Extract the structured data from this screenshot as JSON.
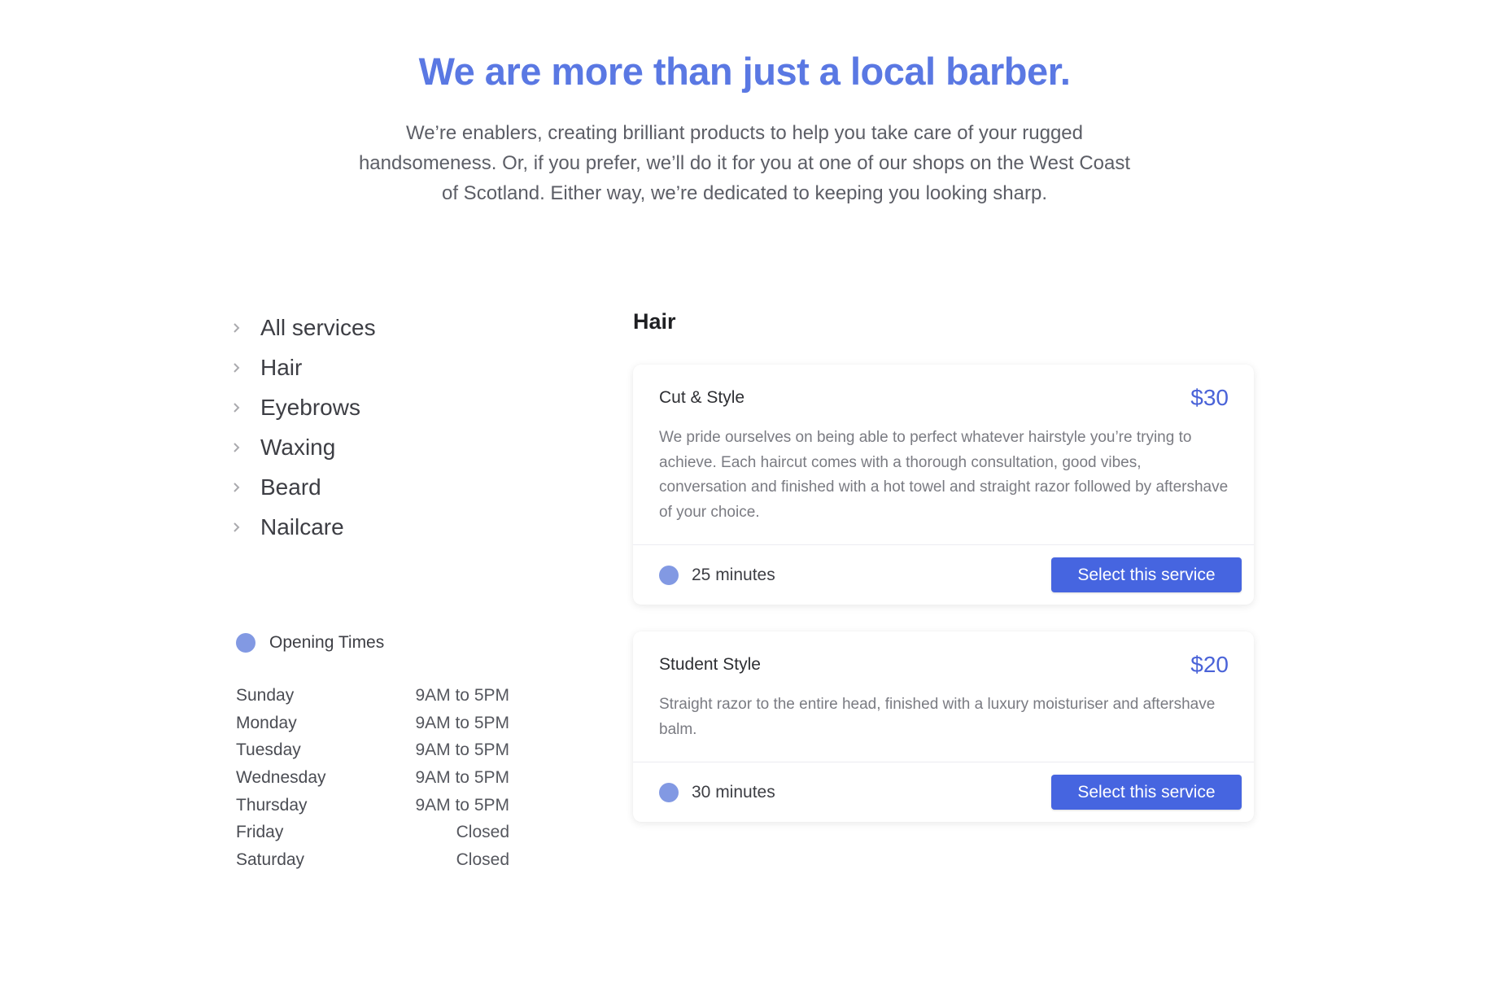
{
  "hero": {
    "title": "We are more than just a local barber.",
    "text": "We’re enablers, creating brilliant products to help you take care of your rugged handsomeness. Or, if you prefer, we’ll do it for you at one of our shops on the West Coast of Scotland. Either way, we’re dedicated to keeping you looking sharp."
  },
  "nav": {
    "items": [
      {
        "label": "All services",
        "icon": "chevron-right-icon"
      },
      {
        "label": "Hair",
        "icon": "chevron-right-icon"
      },
      {
        "label": "Eyebrows",
        "icon": "chevron-right-icon"
      },
      {
        "label": "Waxing",
        "icon": "chevron-right-icon"
      },
      {
        "label": "Beard",
        "icon": "chevron-right-icon"
      },
      {
        "label": "Nailcare",
        "icon": "chevron-right-icon"
      }
    ]
  },
  "opening_times": {
    "title": "Opening Times",
    "icon": "dot-icon",
    "rows": [
      {
        "day": "Sunday",
        "time": "9AM to 5PM"
      },
      {
        "day": "Monday",
        "time": "9AM to 5PM"
      },
      {
        "day": "Tuesday",
        "time": "9AM to 5PM"
      },
      {
        "day": "Wednesday",
        "time": "9AM to 5PM"
      },
      {
        "day": "Thursday",
        "time": "9AM to 5PM"
      },
      {
        "day": "Friday",
        "time": "Closed"
      },
      {
        "day": "Saturday",
        "time": "Closed"
      }
    ]
  },
  "category": {
    "title": "Hair",
    "services": [
      {
        "name": "Cut & Style",
        "price": "$30",
        "description": "We pride ourselves on being able to perfect whatever hairstyle you’re trying to achieve. Each haircut comes with a thorough consultation, good vibes, conversation and finished with a hot towel and straight razor followed by aftershave of your choice.",
        "duration": "25 minutes",
        "button": "Select this service"
      },
      {
        "name": "Student Style",
        "price": "$20",
        "description": "Straight razor to the entire head, finished with a luxury moisturiser and aftershave balm.",
        "duration": "30 minutes",
        "button": "Select this service"
      }
    ]
  },
  "colors": {
    "accent": "#5a78e3",
    "button": "#4665e0",
    "price": "#4a63d8",
    "dot": "#8299e3"
  }
}
